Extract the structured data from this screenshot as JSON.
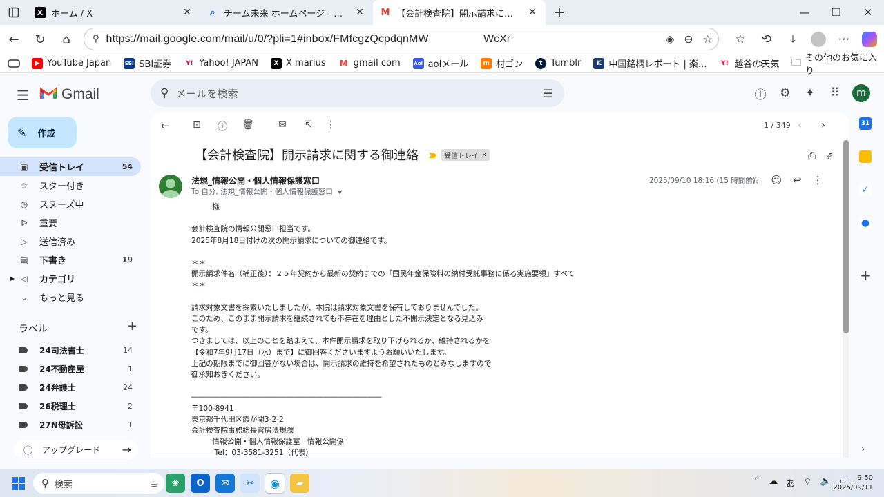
{
  "browser": {
    "tabs": [
      {
        "label": "ホーム / X",
        "favicon": "x-logo-icon"
      },
      {
        "label": "チーム未来 ホームページ - 検索",
        "favicon": "search-icon"
      },
      {
        "label": "【会計検査院】開示請求に関する御連絡",
        "favicon": "gmail-icon",
        "active": true
      }
    ],
    "url_main": "https://mail.google.com/mail/u/0/?pli=1#inbox/FMfcgzQcpdqnMW",
    "url_tail": "WcXr",
    "bookmarks": [
      {
        "label": "YouTube Japan",
        "color": "#ff0000",
        "glyph": "▶"
      },
      {
        "label": "SBI証券",
        "color": "#0b3a8c",
        "glyph": "SBI"
      },
      {
        "label": "Yahoo! JAPAN",
        "color": "#ff0033",
        "glyph": "Y!"
      },
      {
        "label": "X marius",
        "color": "#000000",
        "glyph": "X"
      },
      {
        "label": "gmail com",
        "color": "#ea4335",
        "glyph": "M"
      },
      {
        "label": "aolメール",
        "color": "#3a5bd9",
        "glyph": "Aol"
      },
      {
        "label": "村ゴン",
        "color": "#ff7a00",
        "glyph": "m"
      },
      {
        "label": "Tumblr",
        "color": "#001935",
        "glyph": "t"
      },
      {
        "label": "中国銘柄レポート | 楽...",
        "color": "#1d3a6b",
        "glyph": "K"
      },
      {
        "label": "越谷の天気",
        "color": "#ff0033",
        "glyph": "Y!"
      }
    ],
    "bookmarks_other": "その他のお気に入り"
  },
  "gmail": {
    "brand": "Gmail",
    "search_placeholder": "メールを検索",
    "avatar_letter": "m",
    "compose_label": "作成",
    "nav": [
      {
        "label": "受信トレイ",
        "count": "54",
        "icon": "inbox-icon",
        "active": true
      },
      {
        "label": "スター付き",
        "count": "",
        "icon": "star-icon"
      },
      {
        "label": "スヌーズ中",
        "count": "",
        "icon": "clock-icon"
      },
      {
        "label": "重要",
        "count": "",
        "icon": "important-icon"
      },
      {
        "label": "送信済み",
        "count": "",
        "icon": "send-icon"
      },
      {
        "label": "下書き",
        "count": "19",
        "icon": "draft-icon",
        "bold": true
      },
      {
        "label": "カテゴリ",
        "count": "",
        "icon": "label-icon",
        "bold": true
      },
      {
        "label": "もっと見る",
        "count": "",
        "icon": "chevron-down-icon"
      }
    ],
    "labels_title": "ラベル",
    "labels": [
      {
        "label": "24司法書士",
        "count": "14"
      },
      {
        "label": "24不動産屋",
        "count": "1"
      },
      {
        "label": "24弁護士",
        "count": "24"
      },
      {
        "label": "26税理士",
        "count": "2"
      },
      {
        "label": "27N母訴訟",
        "count": "1"
      }
    ],
    "upgrade_label": "アップグレード"
  },
  "message": {
    "pager": "1 / 349",
    "subject": "【会計検査院】開示請求に関する御連絡",
    "chip": "受信トレイ",
    "sender": "法規_情報公開・個人情報保護窓口",
    "to_line": "To 自分, 法規_情報公開・個人情報保護窓口",
    "date": "2025/09/10 18:16 (15 時間前)",
    "body": "         様\n\n会計検査院の情報公開窓口担当です。\n2025年8月18日付けの次の開示請求についての御連絡です。\n\n＊＊\n開示請求件名（補正後）：２５年契約から最新の契約までの「国民年金保険料の納付受託事務に係る実施要領」すべて\n＊＊\n\n請求対象文書を探索いたしましたが、本院は請求対象文書を保有しておりませんでした。\nこのため、このまま開示請求を継続されても不存在を理由とした不開示決定となる見込み\nです。\nつきましては、以上のことを踏まえて、本件開示請求を取り下げられるか、維持されるかを\n【令和7年9月17日（水）まで】に御回答くださいますようお願いいたします。\n上記の期限までに御回答がない場合は、開示請求の維持を希望されたものとみなしますので\n御承知おきください。\n\n――――――――――――――――――――――――――\n〒100-8941\n東京都千代田区霞が関3-2-2\n会計検査院事務総長官房法規課\n         情報公開・個人情報保護室　情報公開係\n          Tel：03-3581-3251（代表）"
  },
  "taskbar": {
    "search_label": "検索",
    "ime": "あ",
    "time": "9:50",
    "date": "2025/09/11"
  }
}
